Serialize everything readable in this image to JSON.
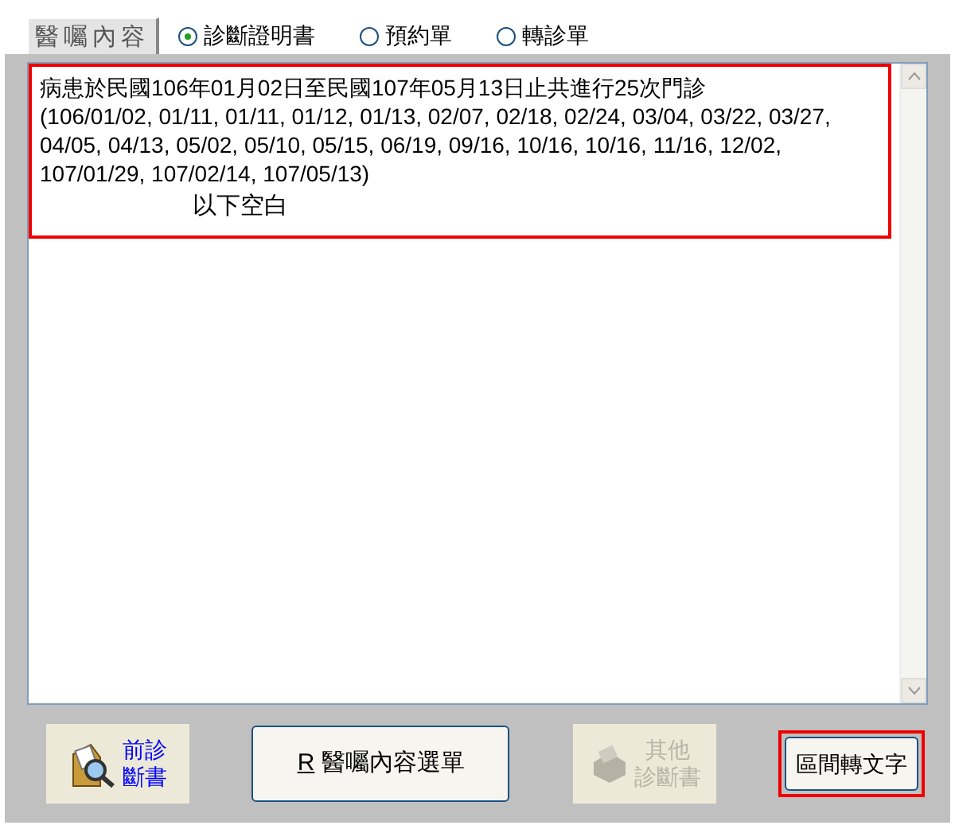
{
  "tab": {
    "label": "醫囑內容"
  },
  "radios": [
    {
      "label": "診斷證明書",
      "selected": true
    },
    {
      "label": "預約單",
      "selected": false
    },
    {
      "label": "轉診單",
      "selected": false
    }
  ],
  "content": {
    "highlighted": true,
    "lines": [
      "病患於民國106年01月02日至民國107年05月13日止共進行25次門診",
      "(106/01/02, 01/11, 01/11, 01/12, 01/13, 02/07, 02/18, 02/24, 03/04, 03/22, 03/27, 04/05, 04/13, 05/02, 05/10, 05/15, 06/19, 09/16, 10/16, 10/16, 11/16, 12/02, 107/01/29, 107/02/14, 107/05/13)"
    ],
    "note": "以下空白"
  },
  "buttons": [
    {
      "kind": "icon",
      "label_1": "前診",
      "label_2": "斷書",
      "disabled": false
    },
    {
      "kind": "accel",
      "accel": "R",
      "label": "醫囑內容選單",
      "disabled": false
    },
    {
      "kind": "icon",
      "label_1": "其他",
      "label_2": "診斷書",
      "disabled": true
    },
    {
      "kind": "plain",
      "label": "區間轉文字",
      "disabled": false,
      "highlighted": true
    }
  ]
}
